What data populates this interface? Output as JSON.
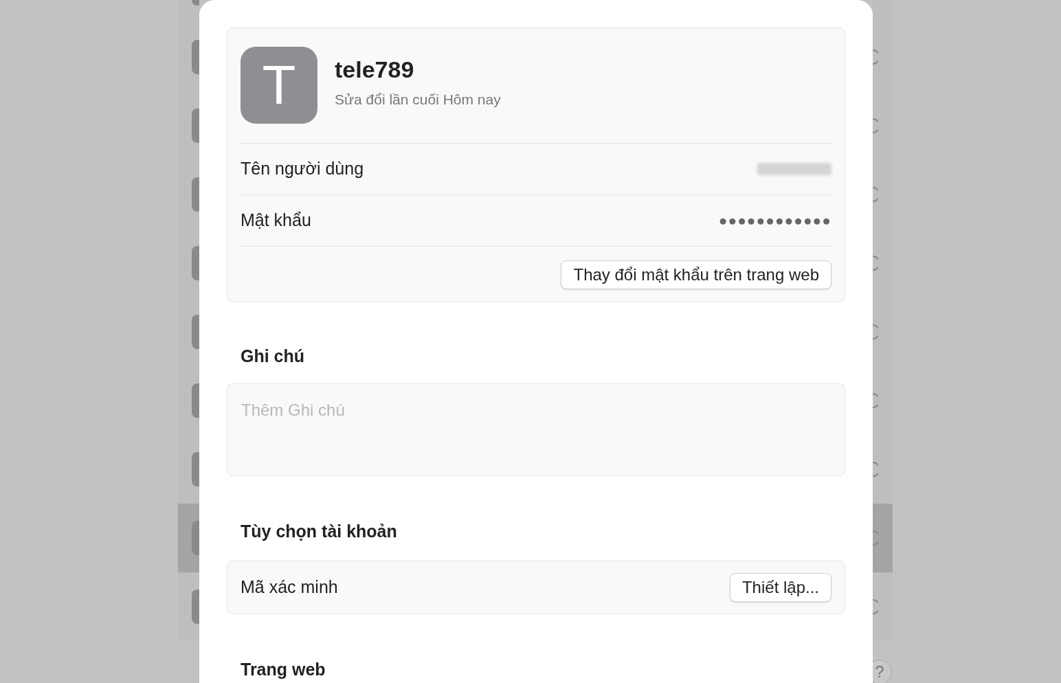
{
  "background_list": {
    "rows": [
      {
        "selected": false
      },
      {
        "selected": false
      },
      {
        "selected": false
      },
      {
        "selected": false
      },
      {
        "selected": false
      },
      {
        "selected": false
      },
      {
        "selected": false
      },
      {
        "selected": false
      },
      {
        "selected": true
      },
      {
        "selected": false
      }
    ]
  },
  "help_button": {
    "label": "?"
  },
  "account": {
    "avatar_letter": "T",
    "title": "tele789",
    "subtitle": "Sửa đổi lần cuối Hôm nay",
    "fields": [
      {
        "label": "Tên người dùng",
        "kind": "redacted"
      },
      {
        "label": "Mật khẩu",
        "value": "●●●●●●●●●●●●",
        "kind": "masked"
      }
    ],
    "change_button": "Thay đổi mật khẩu trên trang web"
  },
  "notes": {
    "heading": "Ghi chú",
    "placeholder": "Thêm Ghi chú"
  },
  "account_options": {
    "heading": "Tùy chọn tài khoản",
    "rows": [
      {
        "label": "Mã xác minh",
        "button": "Thiết lập..."
      }
    ]
  },
  "websites": {
    "heading": "Trang web"
  }
}
